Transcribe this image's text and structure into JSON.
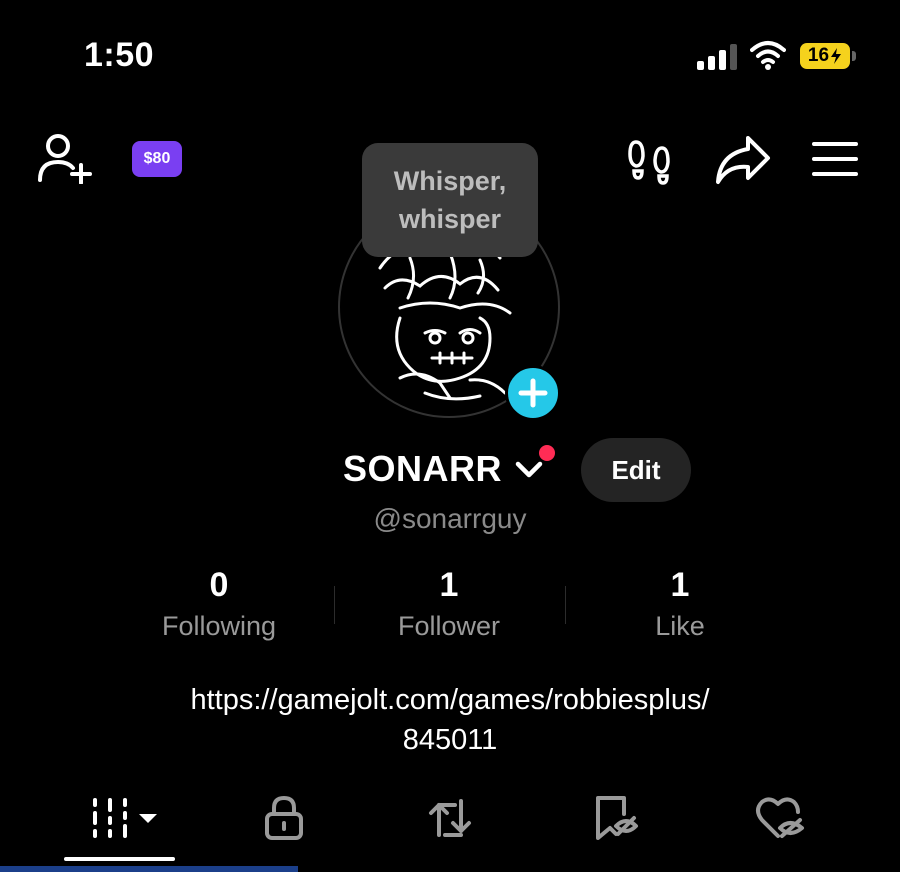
{
  "status_bar": {
    "time": "1:50",
    "battery": "16"
  },
  "header": {
    "coin_label": "$80",
    "icons": [
      "add-user-icon",
      "footprints-icon",
      "share-icon",
      "menu-icon"
    ]
  },
  "bubble": {
    "line1": "Whisper,",
    "line2": "whisper"
  },
  "profile": {
    "name": "SONARR",
    "handle": "@sonarrguy",
    "edit_label": "Edit"
  },
  "stats": [
    {
      "value": "0",
      "label": "Following"
    },
    {
      "value": "1",
      "label": "Follower"
    },
    {
      "value": "1",
      "label": "Like"
    }
  ],
  "bio": {
    "line1": "https://gamejolt.com/games/robbiesplus/",
    "line2": "845011"
  },
  "tabs": [
    "videos-grid-icon",
    "lock-icon",
    "repost-icon",
    "bookmark-hidden-icon",
    "liked-hidden-icon"
  ],
  "colors": {
    "background": "#000000",
    "accent_cyan": "#25c8e8",
    "coin_purple": "#7a3ff2",
    "notification_red": "#ff2c55",
    "battery_yellow": "#f5d21d"
  }
}
